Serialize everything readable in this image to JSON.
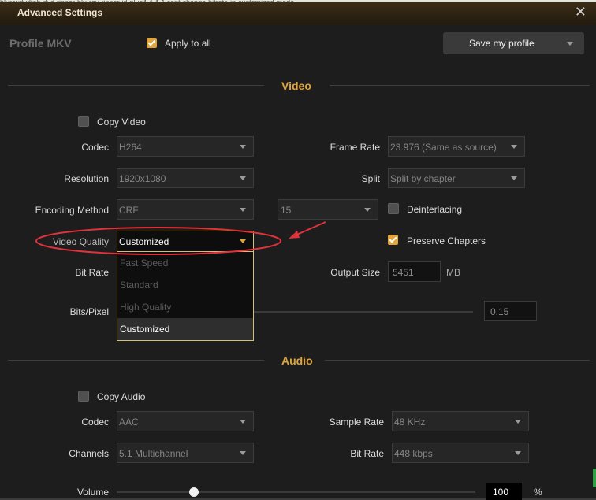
{
  "background_text": "bluraydvdtab-dvd-ripper-blu-ray-ripper-id-plus4.4.4.4-cant-change-bitrate-in-customized-mode",
  "window": {
    "title": "Advanced Settings",
    "close": "✕"
  },
  "header": {
    "profile_label": "Profile",
    "profile_value": "MKV",
    "apply_all": "Apply to all",
    "save_profile": "Save my profile"
  },
  "video": {
    "section": "Video",
    "copy_video": "Copy Video",
    "codec_label": "Codec",
    "codec_value": "H264",
    "resolution_label": "Resolution",
    "resolution_value": "1920x1080",
    "encoding_label": "Encoding Method",
    "encoding_value": "CRF",
    "crf_value": "15",
    "quality_label": "Video Quality",
    "quality_value": "Customized",
    "quality_options": [
      "Fast Speed",
      "Standard",
      "High Quality",
      "Customized"
    ],
    "bitrate_label": "Bit Rate",
    "bitspixel_label": "Bits/Pixel",
    "bitspixel_value": "0.15",
    "framerate_label": "Frame Rate",
    "framerate_value": "23.976 (Same as source)",
    "split_label": "Split",
    "split_value": "Split by chapter",
    "deinterlacing": "Deinterlacing",
    "preserve_chapters": "Preserve Chapters",
    "output_size_label": "Output Size",
    "output_size_value": "5451",
    "output_size_unit": "MB"
  },
  "audio": {
    "section": "Audio",
    "copy_audio": "Copy Audio",
    "codec_label": "Codec",
    "codec_value": "AAC",
    "channels_label": "Channels",
    "channels_value": "5.1 Multichannel",
    "samplerate_label": "Sample Rate",
    "samplerate_value": "48 KHz",
    "bitrate_label": "Bit Rate",
    "bitrate_value": "448 kbps",
    "volume_label": "Volume",
    "volume_value": "100",
    "volume_unit": "%"
  },
  "colors": {
    "accent": "#e0a43a",
    "annotation": "#e0323a"
  },
  "icons": {
    "checkbox_checked": "check-icon",
    "dropdown": "chevron-down-icon",
    "close": "close-icon"
  }
}
